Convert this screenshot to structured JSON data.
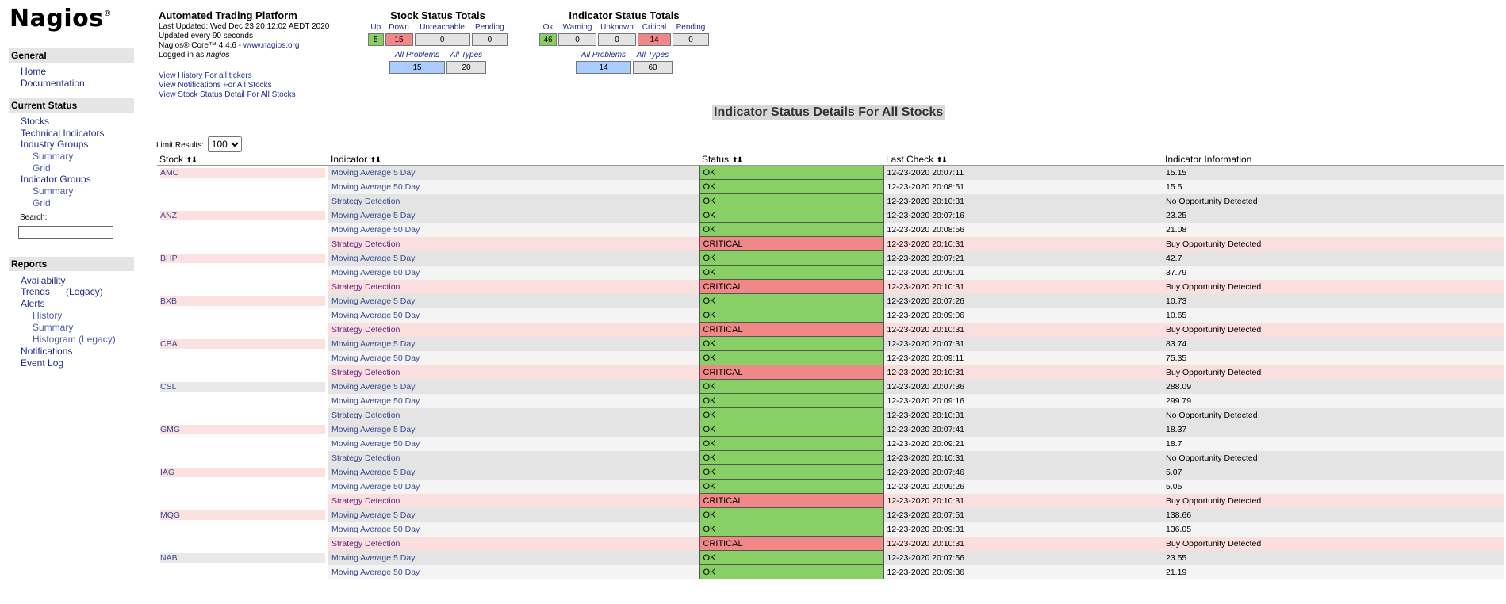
{
  "logo": "Nagios",
  "sidebar": {
    "general": "General",
    "general_links": [
      "Home",
      "Documentation"
    ],
    "current_status": "Current Status",
    "stocks": "Stocks",
    "technical_indicators": "Technical Indicators",
    "industry_groups": "Industry Groups",
    "industry_summary": "Summary",
    "industry_grid": "Grid",
    "indicator_groups": "Indicator Groups",
    "indicator_summary": "Summary",
    "indicator_grid": "Grid",
    "search_label": "Search:",
    "search_value": "",
    "reports": "Reports",
    "availability": "Availability",
    "trends": "Trends",
    "legacy": "(Legacy)",
    "alerts": "Alerts",
    "history": "History",
    "summary": "Summary",
    "histogram": "Histogram (Legacy)",
    "notifications": "Notifications",
    "event_log": "Event Log"
  },
  "info": {
    "title": "Automated Trading Platform",
    "last_updated": "Last Updated: Wed Dec 23 20:12:02 AEDT 2020",
    "updated_every": "Updated every 90 seconds",
    "core_prefix": "Nagios® Core™ 4.4.6 - ",
    "core_link": "www.nagios.org",
    "logged_in_prefix": "Logged in as ",
    "logged_in_user": "nagios",
    "links": [
      "View History For all tickers",
      "View Notifications For All Stocks",
      "View Stock Status Detail For All Stocks"
    ]
  },
  "stock_totals": {
    "title": "Stock Status Totals",
    "labels": [
      "Up",
      "Down",
      "Unreachable",
      "Pending"
    ],
    "values": [
      "5",
      "15",
      "0",
      "0"
    ],
    "sub_labels": [
      "All Problems",
      "All Types"
    ],
    "sub_values": [
      "15",
      "20"
    ]
  },
  "indicator_totals": {
    "title": "Indicator Status Totals",
    "labels": [
      "Ok",
      "Warning",
      "Unknown",
      "Critical",
      "Pending"
    ],
    "values": [
      "46",
      "0",
      "0",
      "14",
      "0"
    ],
    "sub_labels": [
      "All Problems",
      "All Types"
    ],
    "sub_values": [
      "14",
      "60"
    ]
  },
  "detail_title": "Indicator Status Details For All Stocks",
  "limit": {
    "label": "Limit Results:",
    "value": "100"
  },
  "table": {
    "headers": [
      "Stock",
      "Indicator",
      "Status",
      "Last Check",
      "Indicator Information"
    ],
    "rows": [
      [
        "AMC",
        "Moving Average 5 Day",
        "OK",
        "12-23-2020 20:07:11",
        "15.15"
      ],
      [
        "",
        "Moving Average 50 Day",
        "OK",
        "12-23-2020 20:08:51",
        "15.5"
      ],
      [
        "",
        "Strategy Detection",
        "OK",
        "12-23-2020 20:10:31",
        "No Opportunity Detected"
      ],
      [
        "ANZ",
        "Moving Average 5 Day",
        "OK",
        "12-23-2020 20:07:16",
        "23.25"
      ],
      [
        "",
        "Moving Average 50 Day",
        "OK",
        "12-23-2020 20:08:56",
        "21.08"
      ],
      [
        "",
        "Strategy Detection",
        "CRITICAL",
        "12-23-2020 20:10:31",
        "Buy Opportunity Detected"
      ],
      [
        "BHP",
        "Moving Average 5 Day",
        "OK",
        "12-23-2020 20:07:21",
        "42.7"
      ],
      [
        "",
        "Moving Average 50 Day",
        "OK",
        "12-23-2020 20:09:01",
        "37.79"
      ],
      [
        "",
        "Strategy Detection",
        "CRITICAL",
        "12-23-2020 20:10:31",
        "Buy Opportunity Detected"
      ],
      [
        "BXB",
        "Moving Average 5 Day",
        "OK",
        "12-23-2020 20:07:26",
        "10.73"
      ],
      [
        "",
        "Moving Average 50 Day",
        "OK",
        "12-23-2020 20:09:06",
        "10.65"
      ],
      [
        "",
        "Strategy Detection",
        "CRITICAL",
        "12-23-2020 20:10:31",
        "Buy Opportunity Detected"
      ],
      [
        "CBA",
        "Moving Average 5 Day",
        "OK",
        "12-23-2020 20:07:31",
        "83.74"
      ],
      [
        "",
        "Moving Average 50 Day",
        "OK",
        "12-23-2020 20:09:11",
        "75.35"
      ],
      [
        "",
        "Strategy Detection",
        "CRITICAL",
        "12-23-2020 20:10:31",
        "Buy Opportunity Detected"
      ],
      [
        "CSL",
        "Moving Average 5 Day",
        "OK",
        "12-23-2020 20:07:36",
        "288.09"
      ],
      [
        "",
        "Moving Average 50 Day",
        "OK",
        "12-23-2020 20:09:16",
        "299.79"
      ],
      [
        "",
        "Strategy Detection",
        "OK",
        "12-23-2020 20:10:31",
        "No Opportunity Detected"
      ],
      [
        "GMG",
        "Moving Average 5 Day",
        "OK",
        "12-23-2020 20:07:41",
        "18.37"
      ],
      [
        "",
        "Moving Average 50 Day",
        "OK",
        "12-23-2020 20:09:21",
        "18.7"
      ],
      [
        "",
        "Strategy Detection",
        "OK",
        "12-23-2020 20:10:31",
        "No Opportunity Detected"
      ],
      [
        "IAG",
        "Moving Average 5 Day",
        "OK",
        "12-23-2020 20:07:46",
        "5.07"
      ],
      [
        "",
        "Moving Average 50 Day",
        "OK",
        "12-23-2020 20:09:26",
        "5.05"
      ],
      [
        "",
        "Strategy Detection",
        "CRITICAL",
        "12-23-2020 20:10:31",
        "Buy Opportunity Detected"
      ],
      [
        "MQG",
        "Moving Average 5 Day",
        "OK",
        "12-23-2020 20:07:51",
        "138.66"
      ],
      [
        "",
        "Moving Average 50 Day",
        "OK",
        "12-23-2020 20:09:31",
        "136.05"
      ],
      [
        "",
        "Strategy Detection",
        "CRITICAL",
        "12-23-2020 20:10:31",
        "Buy Opportunity Detected"
      ],
      [
        "NAB",
        "Moving Average 5 Day",
        "OK",
        "12-23-2020 20:07:56",
        "23.55"
      ],
      [
        "",
        "Moving Average 50 Day",
        "OK",
        "12-23-2020 20:09:36",
        "21.19"
      ]
    ]
  },
  "colors": {
    "ok": "#88d066",
    "critical": "#f08888",
    "up": "#88d066",
    "down": "#f08888",
    "problems_bg": "#aaccff"
  }
}
